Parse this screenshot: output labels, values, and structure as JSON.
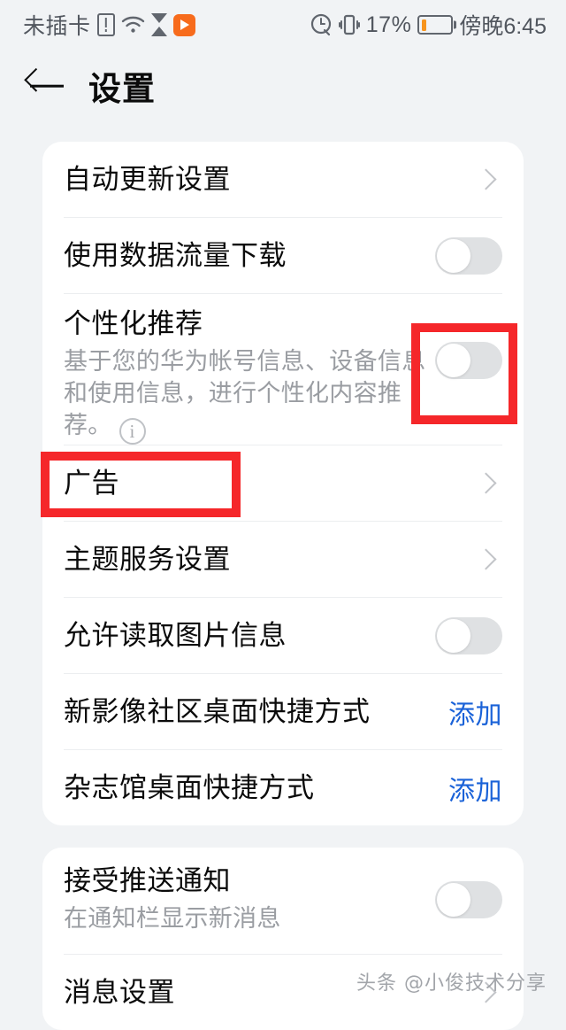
{
  "statusbar": {
    "carrier": "未插卡",
    "sim_icon": "sim-alert-icon",
    "wifi_icon": "wifi-icon",
    "hourglass_icon": "hourglass-icon",
    "app_icon": "orange-play-app-icon",
    "alarm_icon": "alarm-icon",
    "vibrate_icon": "vibrate-icon",
    "battery_percent": "17%",
    "battery_icon": "battery-icon",
    "battery_level": 17,
    "time": "傍晚6:45"
  },
  "header": {
    "back_icon": "back-arrow-icon",
    "title": "设置"
  },
  "card1": {
    "rows": [
      {
        "title": "自动更新设置",
        "accessory": "chevron"
      },
      {
        "title": "使用数据流量下载",
        "accessory": "toggle",
        "toggle_on": false
      },
      {
        "title": "个性化推荐",
        "sub": "基于您的华为帐号信息、设备信息和使用信息，进行个性化内容推荐。",
        "info_icon": "info-circle-icon",
        "accessory": "toggle",
        "toggle_on": false
      },
      {
        "title": "广告",
        "accessory": "chevron"
      },
      {
        "title": "主题服务设置",
        "accessory": "chevron"
      },
      {
        "title": "允许读取图片信息",
        "accessory": "toggle",
        "toggle_on": false
      },
      {
        "title": "新影像社区桌面快捷方式",
        "accessory": "action",
        "action_label": "添加"
      },
      {
        "title": "杂志馆桌面快捷方式",
        "accessory": "action",
        "action_label": "添加"
      }
    ]
  },
  "card2": {
    "rows": [
      {
        "title": "接受推送通知",
        "sub": "在通知栏显示新消息",
        "accessory": "toggle",
        "toggle_on": false
      },
      {
        "title": "消息设置",
        "accessory": "chevron"
      }
    ]
  },
  "highlights": {
    "color": "#f5272a",
    "box_personalized_toggle": "个性化推荐 toggle",
    "box_ads_row": "广告"
  },
  "watermark": "头条 @小俊技术分享",
  "colors": {
    "background": "#f1f3f5",
    "card": "#ffffff",
    "title_text": "#0b0b0b",
    "sub_text": "#9a9da2",
    "accent_link": "#1a62d8",
    "toggle_off_track": "#dfe1e3",
    "highlight_red": "#f5272a",
    "battery_orange": "#f7941d"
  }
}
